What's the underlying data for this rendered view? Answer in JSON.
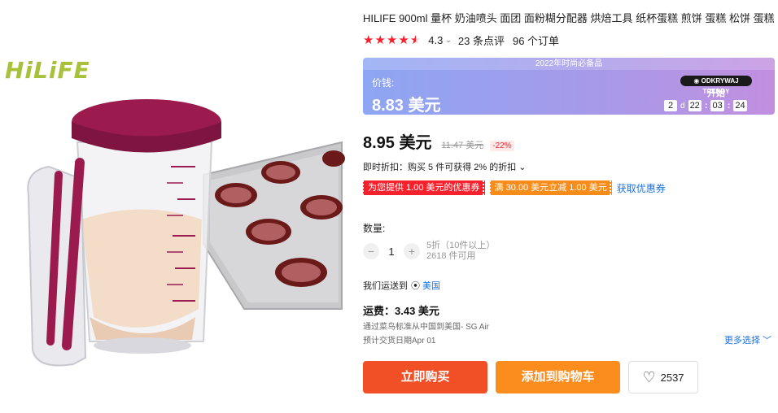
{
  "product": {
    "brand_logo": "HiLiFE",
    "title": "HILIFE 900ml 量杯 奶油喷头 面团 面粉糊分配器 烘焙工具 纸杯蛋糕 煎饼 蛋糕 松饼 蛋糕",
    "rating": "4.3",
    "rating_stars": 4.3,
    "reviews": "23 条点评",
    "orders": "96 个订单"
  },
  "promo": {
    "banner": "2022年时尚必备品",
    "price_label": "价钱:",
    "price": "8.83 美元",
    "trend_badge": "◉ ODKRYWAJ TRENDY",
    "start_label": "开始",
    "countdown": {
      "days": "2",
      "day_unit": "d",
      "hours": "22",
      "minutes": "03",
      "seconds": "24"
    }
  },
  "pricing": {
    "price": "8.95 美元",
    "old_price": "11.47 美元",
    "discount": "-22%"
  },
  "instant_discount": "即时折扣：购买 5 件可获得 2% 的折扣 ⌄",
  "coupons": {
    "red": "为您提供 1.00 美元的优惠券",
    "orange": "满 30.00 美元立减 1.00 美元",
    "get_link": "获取优惠券"
  },
  "quantity": {
    "label": "数量:",
    "minus": "−",
    "value": "1",
    "plus": "+",
    "bulk": "5折（10件以上）",
    "available": "2618 件可用"
  },
  "shipping": {
    "ship_to_label": "我们运送到",
    "country": "美国",
    "freight": "运费：3.43 美元",
    "via": "通过菜鸟标准从中国到美国- SG Air",
    "eta": "预计交货日期Apr 01",
    "more_options": "更多选择 ﹀"
  },
  "actions": {
    "buy_now": "立即购买",
    "add_to_cart": "添加到购物车",
    "wishlist_count": "2537"
  },
  "colors": {
    "accent_red": "#f14f26",
    "accent_orange": "#fb8c1e",
    "star": "#f5222d",
    "link": "#1a73e8",
    "product_lid": "#9b1b4f"
  },
  "icons": [
    "star-icon",
    "chevron-down-icon",
    "location-pin-icon",
    "heart-icon",
    "minus-icon",
    "plus-icon"
  ]
}
